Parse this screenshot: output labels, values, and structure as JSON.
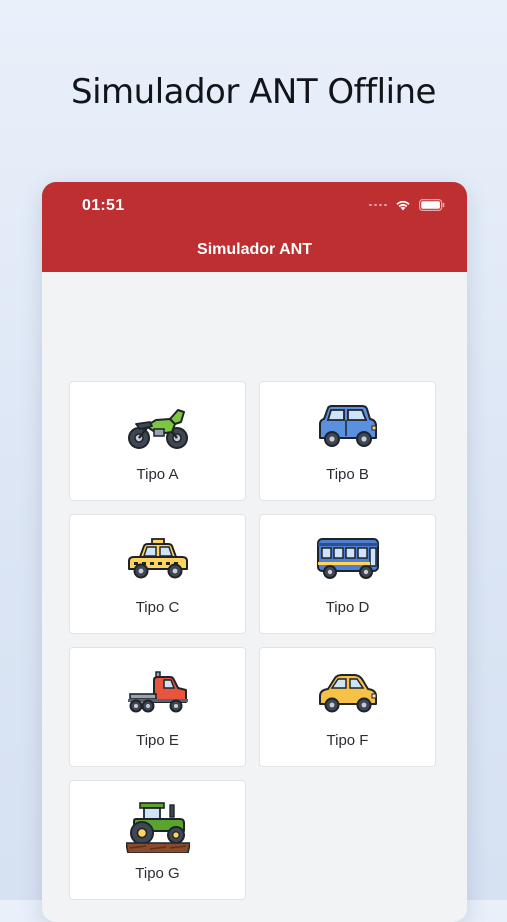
{
  "promo": {
    "title": "Simulador ANT Offline"
  },
  "status_bar": {
    "time": "01:51"
  },
  "navbar": {
    "title": "Simulador ANT"
  },
  "vehicle_types": [
    {
      "label": "Tipo A",
      "icon": "motorcycle-icon"
    },
    {
      "label": "Tipo B",
      "icon": "suv-icon"
    },
    {
      "label": "Tipo C",
      "icon": "taxi-icon"
    },
    {
      "label": "Tipo D",
      "icon": "bus-icon"
    },
    {
      "label": "Tipo E",
      "icon": "truck-icon"
    },
    {
      "label": "Tipo F",
      "icon": "car-icon"
    },
    {
      "label": "Tipo G",
      "icon": "tractor-icon"
    }
  ],
  "colors": {
    "header": "#bd2f30",
    "background": "#f2f3f5",
    "card": "#ffffff"
  }
}
